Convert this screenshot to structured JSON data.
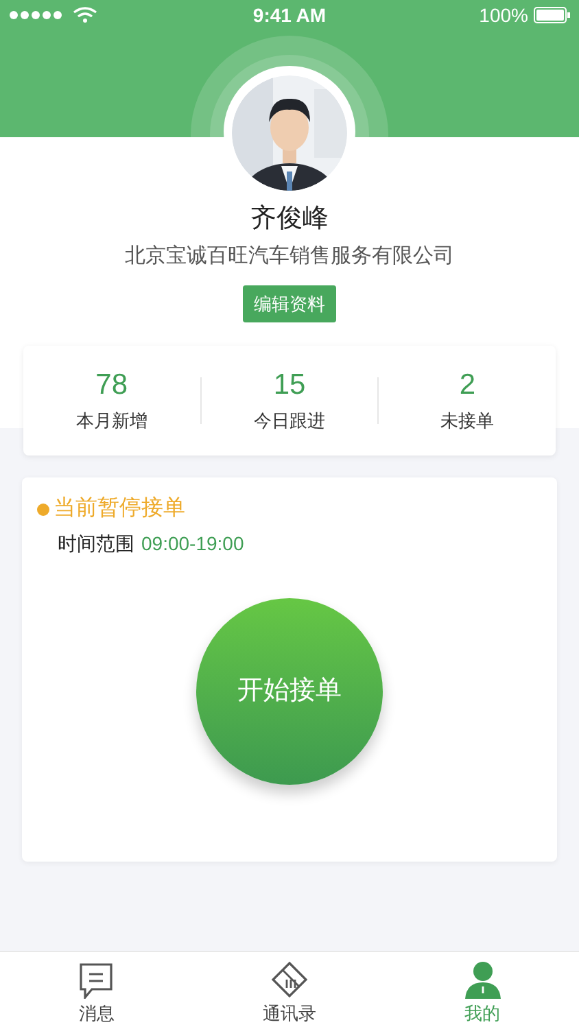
{
  "status_bar": {
    "time": "9:41 AM",
    "battery": "100%"
  },
  "profile": {
    "name": "齐俊峰",
    "company": "北京宝诚百旺汽车销售服务有限公司",
    "edit_button": "编辑资料"
  },
  "stats": [
    {
      "value": "78",
      "label": "本月新增"
    },
    {
      "value": "15",
      "label": "今日跟进"
    },
    {
      "value": "2",
      "label": "未接单"
    }
  ],
  "order_status": {
    "accepting": false,
    "title": "当前暂停接单",
    "range_label": "时间范围",
    "range": "09:00-19:00",
    "action_button": "开始接单"
  },
  "tab_bar": [
    {
      "kind": "message",
      "label": "消息",
      "selected": false
    },
    {
      "kind": "handshake",
      "label": "通讯录",
      "selected": false
    },
    {
      "kind": "person",
      "label": "我的",
      "selected": true
    }
  ]
}
